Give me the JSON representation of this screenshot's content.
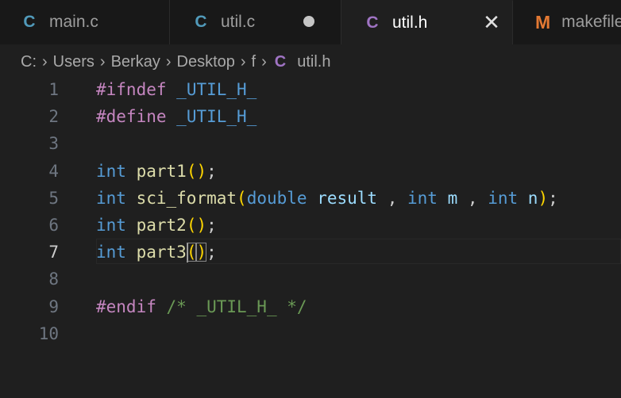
{
  "tabs": [
    {
      "icon": "C",
      "label": "main.c"
    },
    {
      "icon": "C",
      "label": "util.c"
    },
    {
      "icon": "C",
      "label": "util.h"
    },
    {
      "icon": "M",
      "label": "makefile"
    }
  ],
  "close_glyph": "✕",
  "breadcrumb": {
    "items": [
      "C:",
      "Users",
      "Berkay",
      "Desktop",
      "f"
    ],
    "file_icon": "C",
    "file": "util.h",
    "separator": "›"
  },
  "editor": {
    "current_line": 7,
    "lines": [
      {
        "n": "1",
        "tokens": [
          [
            "pp",
            "#ifndef"
          ],
          [
            "punc",
            " "
          ],
          [
            "macro",
            "_UTIL_H_"
          ]
        ]
      },
      {
        "n": "2",
        "tokens": [
          [
            "pp",
            "#define"
          ],
          [
            "punc",
            " "
          ],
          [
            "macro",
            "_UTIL_H_"
          ]
        ]
      },
      {
        "n": "3",
        "tokens": []
      },
      {
        "n": "4",
        "tokens": [
          [
            "kw",
            "int"
          ],
          [
            "punc",
            " "
          ],
          [
            "fn",
            "part1"
          ],
          [
            "brace",
            "()"
          ],
          [
            "punc",
            ";"
          ]
        ]
      },
      {
        "n": "5",
        "tokens": [
          [
            "kw",
            "int"
          ],
          [
            "punc",
            " "
          ],
          [
            "fn",
            "sci_format"
          ],
          [
            "brace",
            "("
          ],
          [
            "kw",
            "double"
          ],
          [
            "punc",
            " "
          ],
          [
            "var",
            "result"
          ],
          [
            "punc",
            " , "
          ],
          [
            "kw",
            "int"
          ],
          [
            "punc",
            " "
          ],
          [
            "var",
            "m"
          ],
          [
            "punc",
            " , "
          ],
          [
            "kw",
            "int"
          ],
          [
            "punc",
            " "
          ],
          [
            "var",
            "n"
          ],
          [
            "brace",
            ")"
          ],
          [
            "punc",
            ";"
          ]
        ]
      },
      {
        "n": "6",
        "tokens": [
          [
            "kw",
            "int"
          ],
          [
            "punc",
            " "
          ],
          [
            "fn",
            "part2"
          ],
          [
            "brace",
            "()"
          ],
          [
            "punc",
            ";"
          ]
        ]
      },
      {
        "n": "7",
        "tokens": [
          [
            "kw",
            "int"
          ],
          [
            "punc",
            " "
          ],
          [
            "fn",
            "part3"
          ],
          [
            "cursor",
            ""
          ],
          [
            "bracematch",
            "("
          ],
          [
            "bracematch",
            ")"
          ],
          [
            "punc",
            ";"
          ]
        ]
      },
      {
        "n": "8",
        "tokens": []
      },
      {
        "n": "9",
        "tokens": [
          [
            "pp",
            "#endif"
          ],
          [
            "punc",
            " "
          ],
          [
            "cmt",
            "/* _UTIL_H_ */"
          ]
        ]
      },
      {
        "n": "10",
        "tokens": []
      }
    ]
  },
  "colors": {
    "background": "#1f1f1f",
    "tabbar": "#181818",
    "c_icon_blue": "#519aba",
    "c_icon_purple": "#a074c4",
    "makefile_icon": "#e37933"
  }
}
